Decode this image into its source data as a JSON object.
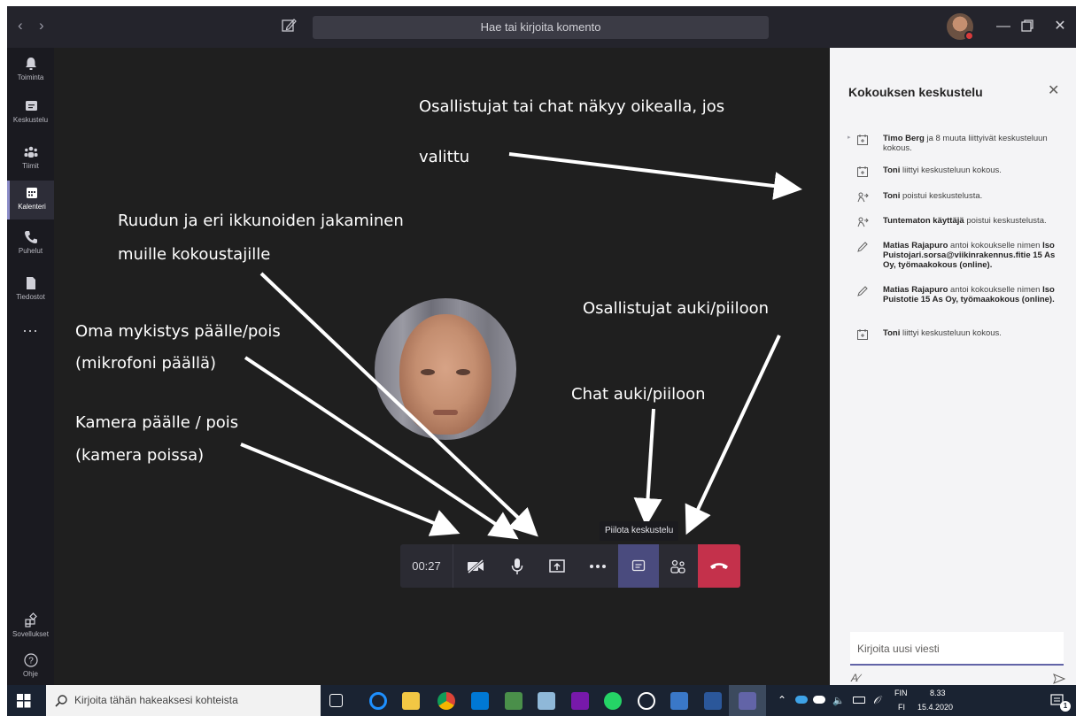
{
  "titlebar": {
    "search_placeholder": "Hae tai kirjoita komento"
  },
  "rail": {
    "items": [
      {
        "label": "Toiminta"
      },
      {
        "label": "Keskustelu"
      },
      {
        "label": "Tiimit"
      },
      {
        "label": "Kalenteri"
      },
      {
        "label": "Puhelut"
      },
      {
        "label": "Tiedostot"
      }
    ],
    "more": "...",
    "apps": "Sovellukset",
    "help": "Ohje"
  },
  "annotations": {
    "participants_chat": "Osallistujat tai chat näkyy oikealla, jos",
    "participants_chat_2": "valittu",
    "screen_share": "Ruudun ja eri ikkunoiden jakaminen",
    "screen_share_2": "muille kokoustajille",
    "mute": "Oma mykistys päälle/pois",
    "mute_2": "(mikrofoni päällä)",
    "camera": "Kamera päälle / pois",
    "camera_2": "(kamera poissa)",
    "participants_toggle": "Osallistujat auki/piiloon",
    "chat_toggle": "Chat auki/piiloon"
  },
  "call": {
    "timer": "00:27",
    "tooltip": "Piilota keskustelu"
  },
  "panel": {
    "title": "Kokouksen keskustelu",
    "compose_placeholder": "Kirjoita uusi viesti",
    "events": [
      {
        "name": "Timo Berg",
        "text": " ja 8 muuta liittyivät keskusteluun kokous.",
        "icon": "calendar-join-icon"
      },
      {
        "name": "Toni",
        "text": " liittyi keskusteluun kokous.",
        "icon": "calendar-join-icon"
      },
      {
        "name": "Toni",
        "text": " poistui keskustelusta.",
        "icon": "person-leave-icon"
      },
      {
        "name": "Tuntematon käyttäjä",
        "text": " poistui keskustelusta.",
        "icon": "person-leave-icon"
      },
      {
        "name": "Matias Rajapuro",
        "text": " antoi kokoukselle nimen ",
        "bold2": "Iso Puistojari.sorsa@viikinrakennus.fitie 15 As Oy, työmaakokous (online).",
        "icon": "pencil-icon"
      },
      {
        "name": "Matias Rajapuro",
        "text": " antoi kokoukselle nimen ",
        "bold2": "Iso Puistotie 15 As Oy, työmaakokous (online).",
        "icon": "pencil-icon"
      },
      {
        "name": "Toni",
        "text": " liittyi keskusteluun kokous.",
        "icon": "calendar-join-icon"
      }
    ]
  },
  "taskbar": {
    "search_placeholder": "Kirjoita tähän hakeaksesi kohteista",
    "lang_top": "FIN",
    "lang_bottom": "FI",
    "time": "8.33",
    "date": "15.4.2020",
    "notif_count": "1"
  },
  "colors": {
    "accent": "#6264a7",
    "hangup": "#c4314b",
    "stage": "#1f1f1f",
    "panel": "#f4f4f6"
  }
}
